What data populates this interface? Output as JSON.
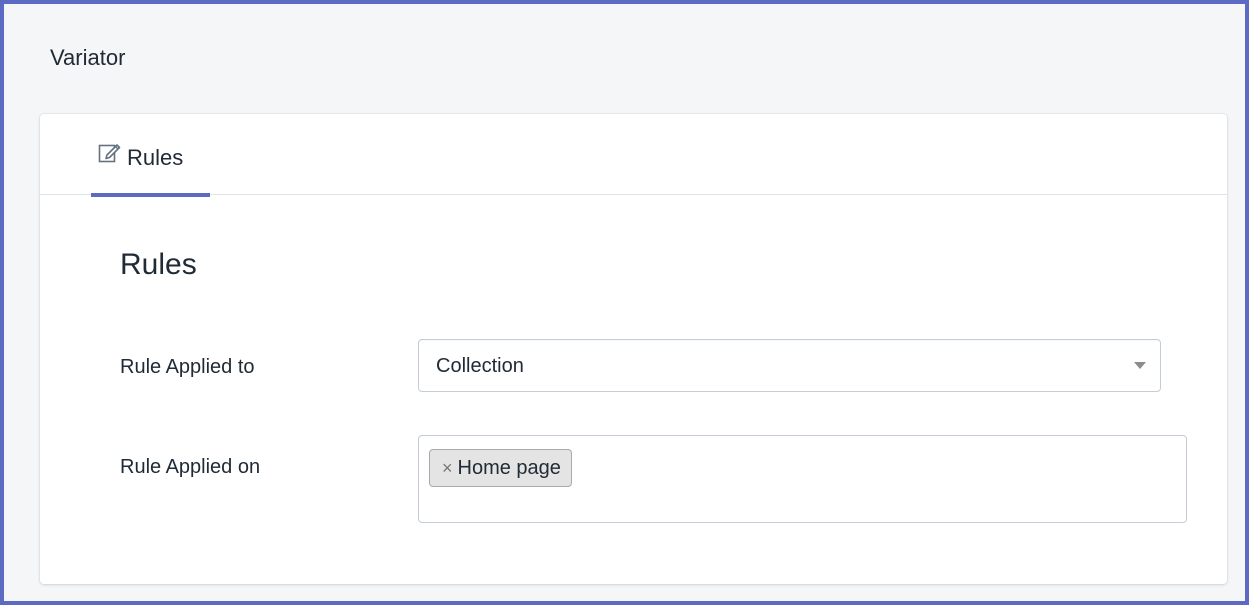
{
  "app": {
    "title": "Variator"
  },
  "tabs": [
    {
      "label": "Rules",
      "icon": "edit-icon",
      "active": true
    }
  ],
  "section": {
    "title": "Rules"
  },
  "form": {
    "rule_applied_to": {
      "label": "Rule Applied to",
      "value": "Collection"
    },
    "rule_applied_on": {
      "label": "Rule Applied on",
      "tags": [
        {
          "remove_symbol": "×",
          "label": "Home page"
        }
      ],
      "input_value": ""
    }
  },
  "colors": {
    "accent": "#5c6ac4",
    "text": "#212b36",
    "border": "#c4cdd5",
    "tag_bg": "#e4e4e4"
  }
}
